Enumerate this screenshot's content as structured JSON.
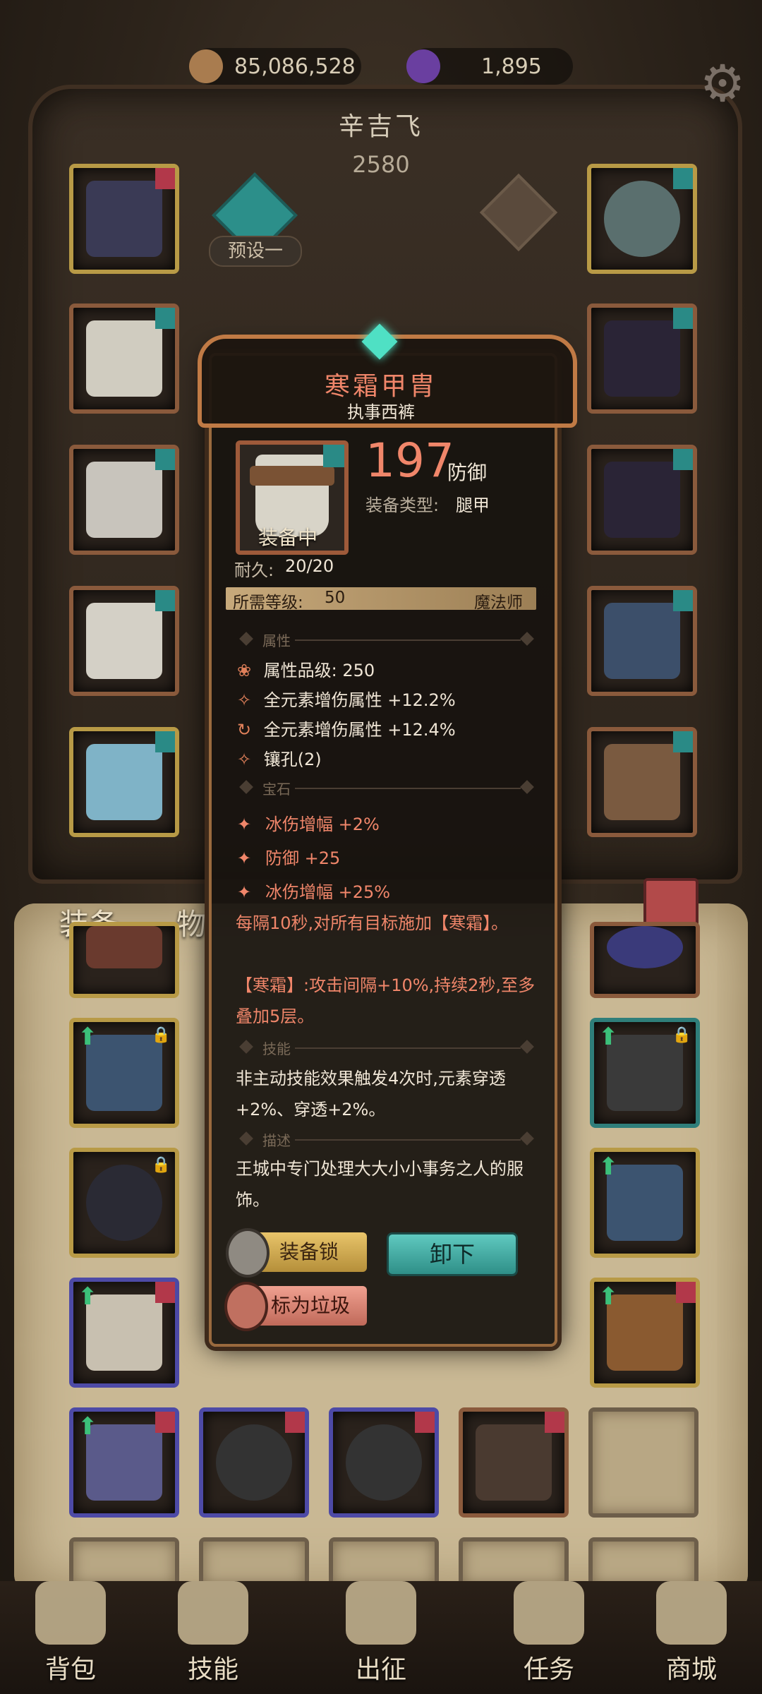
{
  "currency": {
    "gold": "85,086,528",
    "gem": "1,895"
  },
  "icons": {
    "gold": "gold-coin-icon",
    "gem": "purple-crystal-icon",
    "settings": "gear-icon"
  },
  "character": {
    "name": "辛吉飞",
    "power": "2580",
    "preset_label": "预设一"
  },
  "tabs": {
    "equipment": "装备",
    "items": "物"
  },
  "tooltip": {
    "title": "寒霜甲胄",
    "subtitle": "执事西裤",
    "value": "197",
    "value_unit": "防御",
    "type_label": "装备类型:",
    "type_value": "腿甲",
    "equipped_badge": "装备中",
    "durability_label": "耐久:",
    "durability_value": "20/20",
    "required_level_label": "所需等级:",
    "required_level_value": "50",
    "class": "魔法师",
    "section_attributes": "属性",
    "attributes": [
      "属性品级: 250",
      "全元素增伤属性 +12.2%",
      "全元素增伤属性 +12.4%",
      "镶孔(2)"
    ],
    "section_gems": "宝石",
    "gems": [
      "冰伤增幅 +2%",
      "防御 +25",
      "冰伤增幅 +25%"
    ],
    "effect_1": "每隔10秒,对所有目标施加【寒霜】。",
    "effect_2": "【寒霜】:攻击间隔+10%,持续2秒,至多叠加5层。",
    "section_skill": "技能",
    "skill_text": "非主动技能效果触发4次时,元素穿透+2%、穿透+2%。",
    "section_description": "描述",
    "description": "王城中专门处理大大小小事务之人的服饰。",
    "buttons": {
      "lock": "装备锁",
      "unequip": "卸下",
      "mark_trash": "标为垃圾"
    }
  },
  "nav": [
    "背包",
    "技能",
    "出征",
    "任务",
    "商城"
  ],
  "colors": {
    "accent_red": "#f0866a",
    "teal": "#2f8f88",
    "gold": "#b89a46"
  }
}
